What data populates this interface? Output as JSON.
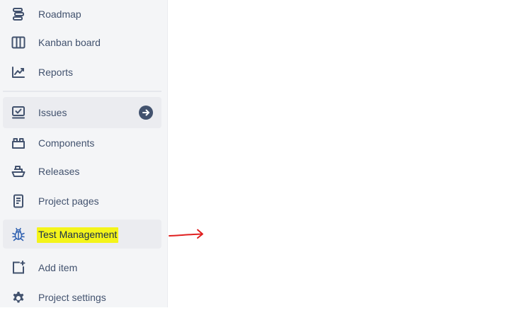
{
  "sidebar": {
    "items": [
      {
        "label": "Roadmap",
        "icon": "roadmap-icon"
      },
      {
        "label": "Kanban board",
        "icon": "kanban-board-icon"
      },
      {
        "label": "Reports",
        "icon": "reports-icon"
      },
      {
        "label": "Issues",
        "icon": "issues-icon",
        "badge_icon": "arrow-right-circle-icon"
      },
      {
        "label": "Components",
        "icon": "components-icon"
      },
      {
        "label": "Releases",
        "icon": "releases-icon"
      },
      {
        "label": "Project pages",
        "icon": "project-pages-icon"
      },
      {
        "label": "Test Management",
        "icon": "bug-icon"
      },
      {
        "label": "Add item",
        "icon": "add-item-icon"
      },
      {
        "label": "Project settings",
        "icon": "gear-icon"
      }
    ]
  },
  "colors": {
    "sidebar_bg": "#f4f5f7",
    "active_bg": "#ebecf0",
    "text": "#42526e",
    "highlight": "#f4f41a",
    "annotation_arrow": "#e02020",
    "test_management_icon": "#2d5fb0"
  }
}
